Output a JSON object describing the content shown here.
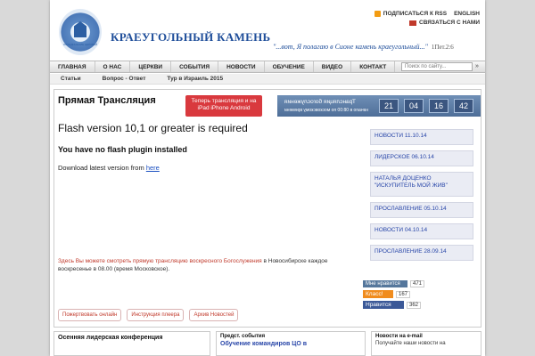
{
  "header": {
    "logo_text": "ОБЪЕДИНЕНИЕ ЦЕРКВЕЙ",
    "title": "КРАЕУГОЛЬНЫЙ КАМЕНЬ",
    "quote": "\"...вот, Я полагаю в Сионе камень краеугольный...\"",
    "quote_ref": "1Пет.2:6",
    "subscribe_rss": "ПОДПИСАТЬСЯ К RSS",
    "english": "ENGLISH",
    "contact_us": "СВЯЗАТЬСЯ С НАМИ"
  },
  "nav": {
    "items": [
      "ГЛАВНАЯ",
      "О НАС",
      "ЦЕРКВИ",
      "СОБЫТИЯ",
      "НОВОСТИ",
      "ОБУЧЕНИЕ",
      "ВИДЕО",
      "КОНТАКТ"
    ],
    "search_placeholder": "Поиск по сайту...",
    "search_button": "»"
  },
  "subnav": {
    "items": [
      "Статьи",
      "Вопрос - Ответ",
      "Тур в Израиль 2015"
    ]
  },
  "main": {
    "title": "Прямая Трансляция",
    "ipad_button": "Теперь трансляция и на iPad iPhone Android",
    "flash_box_line1": "Трансляция богослужения",
    "flash_box_line2": "начало в 08:00 по московскому времени",
    "countdown": [
      "21",
      "04",
      "16",
      "42"
    ],
    "flash_title": "Flash version 10,1 or greater is required",
    "no_plugin": "You have no flash plugin installed",
    "download_text": "Download latest version from",
    "download_link": "here",
    "desc_red": "Здесь Вы можете смотреть прямую трансляцию воскресного Богослужения",
    "desc_rest": " в Новосибирске каждое воскресенье в 08.00 (время Московское).",
    "buttons": [
      "Пожертвовать онлайн",
      "Инструкция плеера",
      "Архив Новостей"
    ]
  },
  "news": [
    "НОВОСТИ 11.10.14",
    "ЛИДЕРСКОЕ 06.10.14",
    "НАТАЛЬЯ ДОЦЕНКО \"ИСКУПИТЕЛЬ МОЙ ЖИВ\"",
    "ПРОСЛАВЛЕНИЕ 05.10.14",
    "НОВОСТИ 04.10.14",
    "ПРОСЛАВЛЕНИЕ 28.09.14"
  ],
  "social": {
    "vk_label": "Мне нравится",
    "vk_count": "471",
    "ok_label": "Класс!",
    "ok_count": "167",
    "fb_label": "Нравится",
    "fb_count": "362"
  },
  "bottom": {
    "col1_title": "Осенняя лидерская конференция",
    "col2_title": "Предст. события",
    "col2_link": "Обучение командиров ЦО в",
    "col3_title": "Новости на e-mail",
    "col3_text": "Получайте наши новости на"
  }
}
